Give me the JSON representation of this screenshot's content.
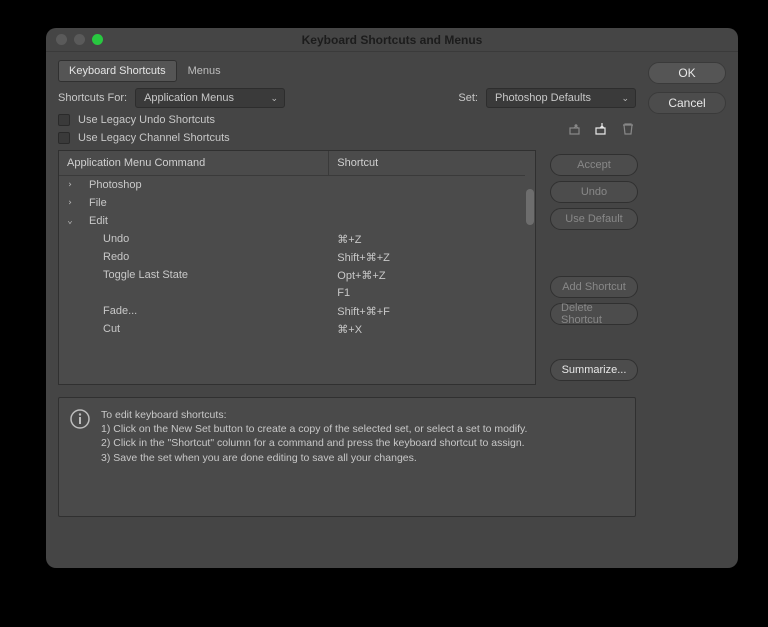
{
  "window": {
    "title": "Keyboard Shortcuts and Menus"
  },
  "tabs": {
    "shortcuts": "Keyboard Shortcuts",
    "menus": "Menus"
  },
  "shortcuts_for": {
    "label": "Shortcuts For:",
    "value": "Application Menus"
  },
  "set": {
    "label": "Set:",
    "value": "Photoshop Defaults"
  },
  "legacy_undo": "Use Legacy Undo Shortcuts",
  "legacy_channel": "Use Legacy Channel Shortcuts",
  "icons": {
    "new_set": "new-set-icon",
    "save_set": "save-set-icon",
    "delete_set": "trash-icon"
  },
  "table": {
    "header_command": "Application Menu Command",
    "header_shortcut": "Shortcut",
    "rows": [
      {
        "disclosure": "›",
        "indent": 0,
        "label": "Photoshop",
        "shortcut": ""
      },
      {
        "disclosure": "›",
        "indent": 0,
        "label": "File",
        "shortcut": ""
      },
      {
        "disclosure": "⌄",
        "indent": 0,
        "label": "Edit",
        "shortcut": ""
      },
      {
        "disclosure": "",
        "indent": 1,
        "label": "Undo",
        "shortcut": "⌘+Z"
      },
      {
        "disclosure": "",
        "indent": 1,
        "label": "Redo",
        "shortcut": "Shift+⌘+Z"
      },
      {
        "disclosure": "",
        "indent": 1,
        "label": "Toggle Last State",
        "shortcut": "Opt+⌘+Z"
      },
      {
        "disclosure": "",
        "indent": 1,
        "label": "",
        "shortcut": "F1"
      },
      {
        "disclosure": "",
        "indent": 1,
        "label": "Fade...",
        "shortcut": "Shift+⌘+F"
      },
      {
        "disclosure": "",
        "indent": 1,
        "label": "Cut",
        "shortcut": "⌘+X"
      }
    ]
  },
  "buttons": {
    "accept": "Accept",
    "undo": "Undo",
    "use_default": "Use Default",
    "add_shortcut": "Add Shortcut",
    "delete_shortcut": "Delete Shortcut",
    "summarize": "Summarize..."
  },
  "info": {
    "intro": "To edit keyboard shortcuts:",
    "l1": "1) Click on the New Set button to create a copy of the selected set, or select a set to modify.",
    "l2": "2) Click in the \"Shortcut\" column for a command and press the keyboard shortcut to assign.",
    "l3": "3) Save the set when you are done editing to save all your changes."
  },
  "side": {
    "ok": "OK",
    "cancel": "Cancel"
  }
}
